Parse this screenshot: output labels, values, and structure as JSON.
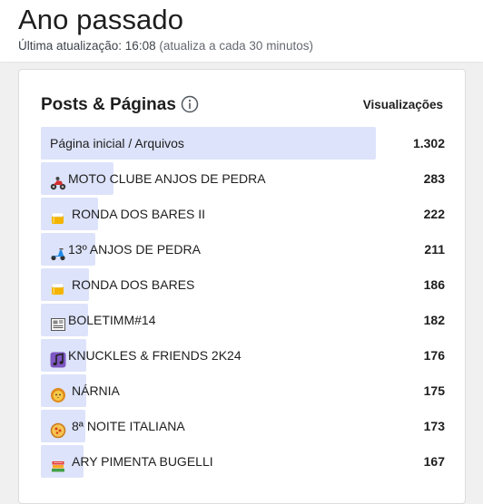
{
  "header": {
    "title": "Ano passado",
    "updated_prefix": "Última atualização: 16:08",
    "updated_interval": "(atualiza a cada 30 minutos)"
  },
  "card": {
    "title": "Posts & Páginas",
    "info_icon": "info-circle-icon",
    "column_header": "Visualizações"
  },
  "accent_bar_color": "#dde3fa",
  "max_views": 1302,
  "rows": [
    {
      "label": "Página inicial / Arquivos",
      "views": "1.302",
      "value": 1302,
      "icon": null
    },
    {
      "label": "MOTO CLUBE ANJOS DE PEDRA",
      "views": "283",
      "value": 283,
      "icon": "motorcycle-icon"
    },
    {
      "label": "RONDA DOS BARES II",
      "views": "222",
      "value": 222,
      "icon": "beer-mug-icon"
    },
    {
      "label": "13º ANJOS DE PEDRA",
      "views": "211",
      "value": 211,
      "icon": "scooter-icon"
    },
    {
      "label": "RONDA DOS BARES",
      "views": "186",
      "value": 186,
      "icon": "beer-mug-icon"
    },
    {
      "label": "BOLETIMM#14",
      "views": "182",
      "value": 182,
      "icon": "newspaper-icon"
    },
    {
      "label": "KNUCKLES & FRIENDS 2K24",
      "views": "176",
      "value": 176,
      "icon": "music-notes-icon"
    },
    {
      "label": "NÁRNIA",
      "views": "175",
      "value": 175,
      "icon": "lion-face-icon"
    },
    {
      "label": "8ª NOITE ITALIANA",
      "views": "173",
      "value": 173,
      "icon": "pizza-icon"
    },
    {
      "label": "ARY PIMENTA BUGELLI",
      "views": "167",
      "value": 167,
      "icon": "books-icon"
    }
  ]
}
